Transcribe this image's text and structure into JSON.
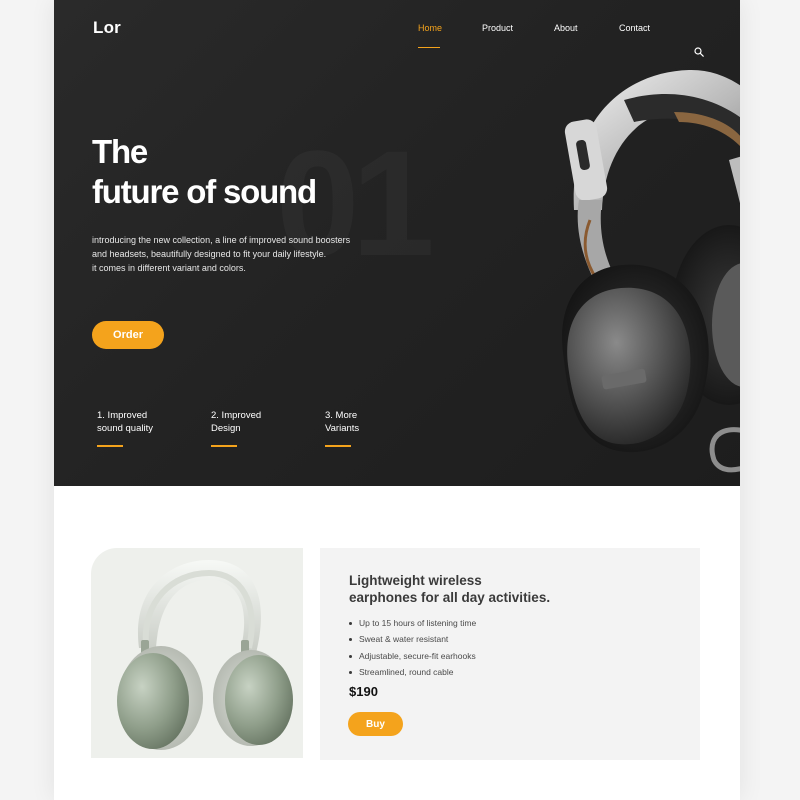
{
  "brand": {
    "logo": "Lor"
  },
  "nav": {
    "items": [
      {
        "label": "Home",
        "active": true
      },
      {
        "label": "Product",
        "active": false
      },
      {
        "label": "About",
        "active": false
      },
      {
        "label": "Contact",
        "active": false
      }
    ],
    "search_icon": "search-icon"
  },
  "hero": {
    "title_line1": "The",
    "title_line2": "future of sound",
    "watermark": "01",
    "description_lines": [
      "introducing the new collection, a line of improved sound boosters",
      "and headsets, beautifully designed to fit your daily lifestyle.",
      "it comes in different variant and colors."
    ],
    "order_label": "Order",
    "features": [
      {
        "line1": "1. Improved",
        "line2": "sound quality"
      },
      {
        "line1": "2. Improved",
        "line2": "Design"
      },
      {
        "line1": "3. More",
        "line2": "Variants"
      }
    ]
  },
  "product": {
    "title_line1": "Lightweight wireless",
    "title_line2": "earphones for all day activities.",
    "features": [
      "Up to 15 hours of listening time",
      "Sweat & water resistant",
      "Adjustable, secure-fit earhooks",
      "Streamlined, round cable"
    ],
    "price": "$190",
    "buy_label": "Buy"
  },
  "colors": {
    "accent": "#f4a31c",
    "hero_bg": "#252525",
    "card_bg": "#f3f3f3",
    "image_bg": "#eef0ec"
  }
}
